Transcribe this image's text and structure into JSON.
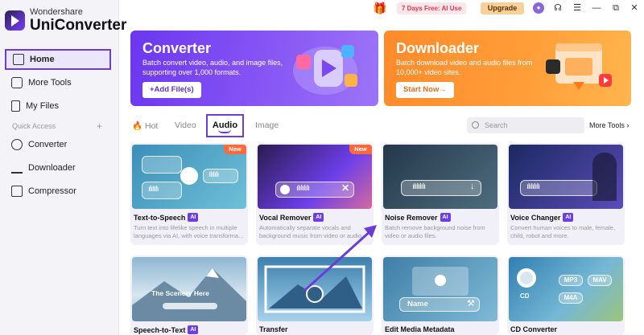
{
  "brand": {
    "small": "Wondershare",
    "big": "UniConverter"
  },
  "sidebar": {
    "items": [
      {
        "label": "Home",
        "icon": "home-icon"
      },
      {
        "label": "More Tools",
        "icon": "toolbox-icon"
      },
      {
        "label": "My Files",
        "icon": "file-icon"
      },
      {
        "label": "Converter",
        "icon": "converter-icon"
      },
      {
        "label": "Downloader",
        "icon": "download-icon"
      },
      {
        "label": "Compressor",
        "icon": "compress-icon"
      }
    ],
    "quick_access": "Quick Access",
    "quick_plus": "+"
  },
  "topbar": {
    "promo": "7 Days Free: AI Use",
    "upgrade": "Upgrade",
    "minimize": "—",
    "maximize": "⧉",
    "close": "✕"
  },
  "banners": {
    "converter": {
      "title": "Converter",
      "desc": "Batch convert video, audio, and image files, supporting over 1,000 formats.",
      "button": "+Add File(s)"
    },
    "downloader": {
      "title": "Downloader",
      "desc": "Batch download video and audio files from 10,000+ video sites.",
      "button": "Start Now→"
    }
  },
  "tabs": {
    "hot": "Hot",
    "video": "Video",
    "audio": "Audio",
    "image": "Image"
  },
  "search": {
    "placeholder": "Search"
  },
  "more_tools": "More Tools",
  "cards": [
    {
      "name": "Text-to-Speech",
      "ai": "AI",
      "new": "New",
      "desc": "Turn text into lifelike speech in multiple languages via AI, with voice transforma..."
    },
    {
      "name": "Vocal Remover",
      "ai": "AI",
      "new": "New",
      "desc": "Automatically separate vocals and background music from video or audio."
    },
    {
      "name": "Noise Remover",
      "ai": "AI",
      "desc": "Batch remove background noise from video or audio files."
    },
    {
      "name": "Voice Changer",
      "ai": "AI",
      "desc": "Convert human voices to male, female, child, robot and more."
    },
    {
      "name": "Speech-to-Text",
      "ai": "AI",
      "thumb_text": "The Scenery Here"
    },
    {
      "name": "Transfer"
    },
    {
      "name": "Edit Media Metadata",
      "thumb_text": "Name"
    },
    {
      "name": "CD Converter",
      "thumb_cd": "CD",
      "thumb_mp3": "MP3",
      "thumb_mav": "MAV",
      "thumb_m4a": "M4A"
    }
  ],
  "colors": {
    "accent": "#6a3dd9",
    "converter_banner": "#7a47f2",
    "downloader_banner": "#ff962f",
    "promo": "#e2364f",
    "upgrade": "#f9cf9a"
  }
}
